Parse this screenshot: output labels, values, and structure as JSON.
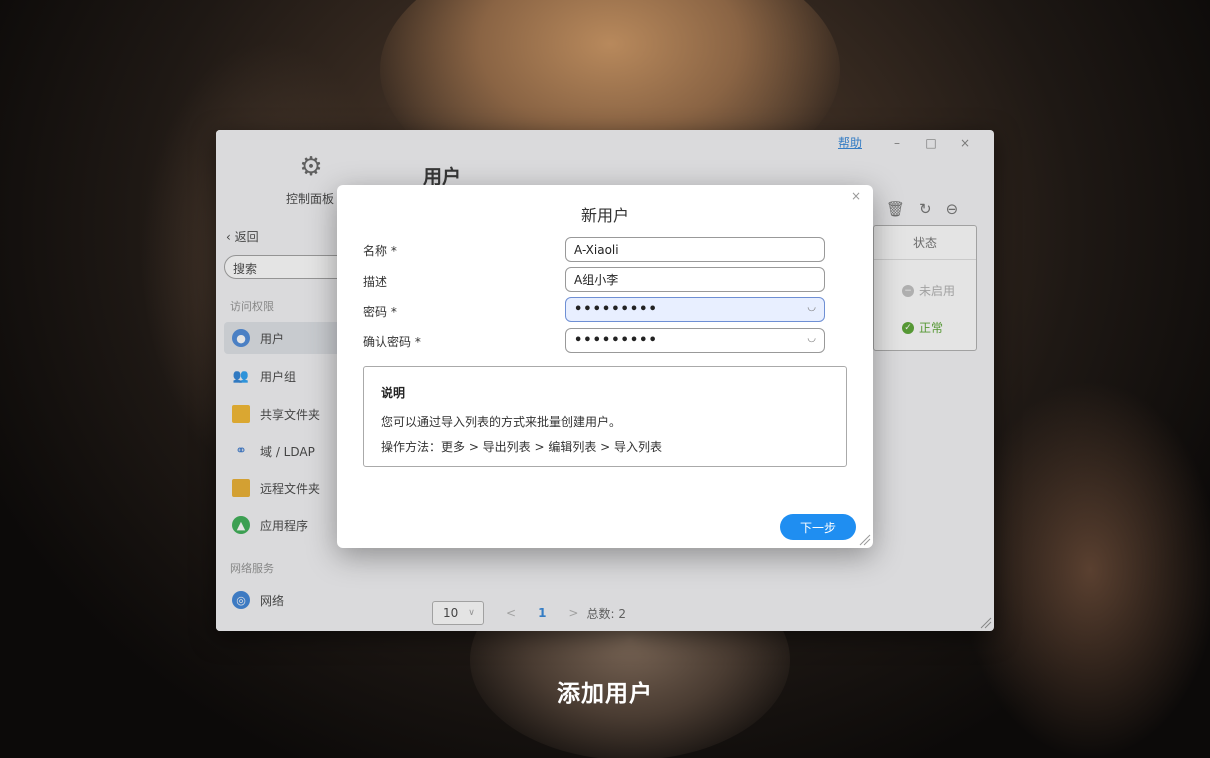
{
  "caption": "添加用户",
  "window": {
    "app_name": "控制面板",
    "page_title": "用户",
    "help_label": "帮助",
    "minimize_label": "–",
    "maximize_label": "□",
    "close_label": "×"
  },
  "sidebar": {
    "back_label": "返回",
    "search_placeholder": "搜索",
    "section_access": "访问权限",
    "section_network": "网络服务",
    "items": [
      {
        "label": "用户",
        "icon": "user-icon"
      },
      {
        "label": "用户组",
        "icon": "group-icon"
      },
      {
        "label": "共享文件夹",
        "icon": "folder-icon"
      },
      {
        "label": "域 / LDAP",
        "icon": "domain-icon"
      },
      {
        "label": "远程文件夹",
        "icon": "remote-folder-icon"
      },
      {
        "label": "应用程序",
        "icon": "app-icon"
      },
      {
        "label": "网络",
        "icon": "network-icon"
      }
    ]
  },
  "table": {
    "status_header": "状态",
    "rows": [
      {
        "status": "未启用",
        "color": "#bbbbbb"
      },
      {
        "status": "正常",
        "color": "#4a9e1f"
      }
    ]
  },
  "pager": {
    "page_size": "10",
    "prev": "<",
    "current_page": "1",
    "next": ">",
    "total": "总数: 2"
  },
  "dialog": {
    "title": "新用户",
    "close_label": "×",
    "fields": {
      "name_label": "名称 *",
      "name_value": "A-Xiaoli",
      "desc_label": "描述",
      "desc_value": "A组小李",
      "password_label": "密码 *",
      "password_value": "•••••••••",
      "confirm_label": "确认密码 *",
      "confirm_value": "•••••••••"
    },
    "note": {
      "title": "说明",
      "line1": "您可以通过导入列表的方式来批量创建用户。",
      "line2": "操作方法：更多 > 导出列表 > 编辑列表 > 导入列表"
    },
    "next_button": "下一步"
  },
  "colors": {
    "accent": "#1f8ef1",
    "link": "#1e7ad6",
    "focus_field": "#e8efff"
  }
}
